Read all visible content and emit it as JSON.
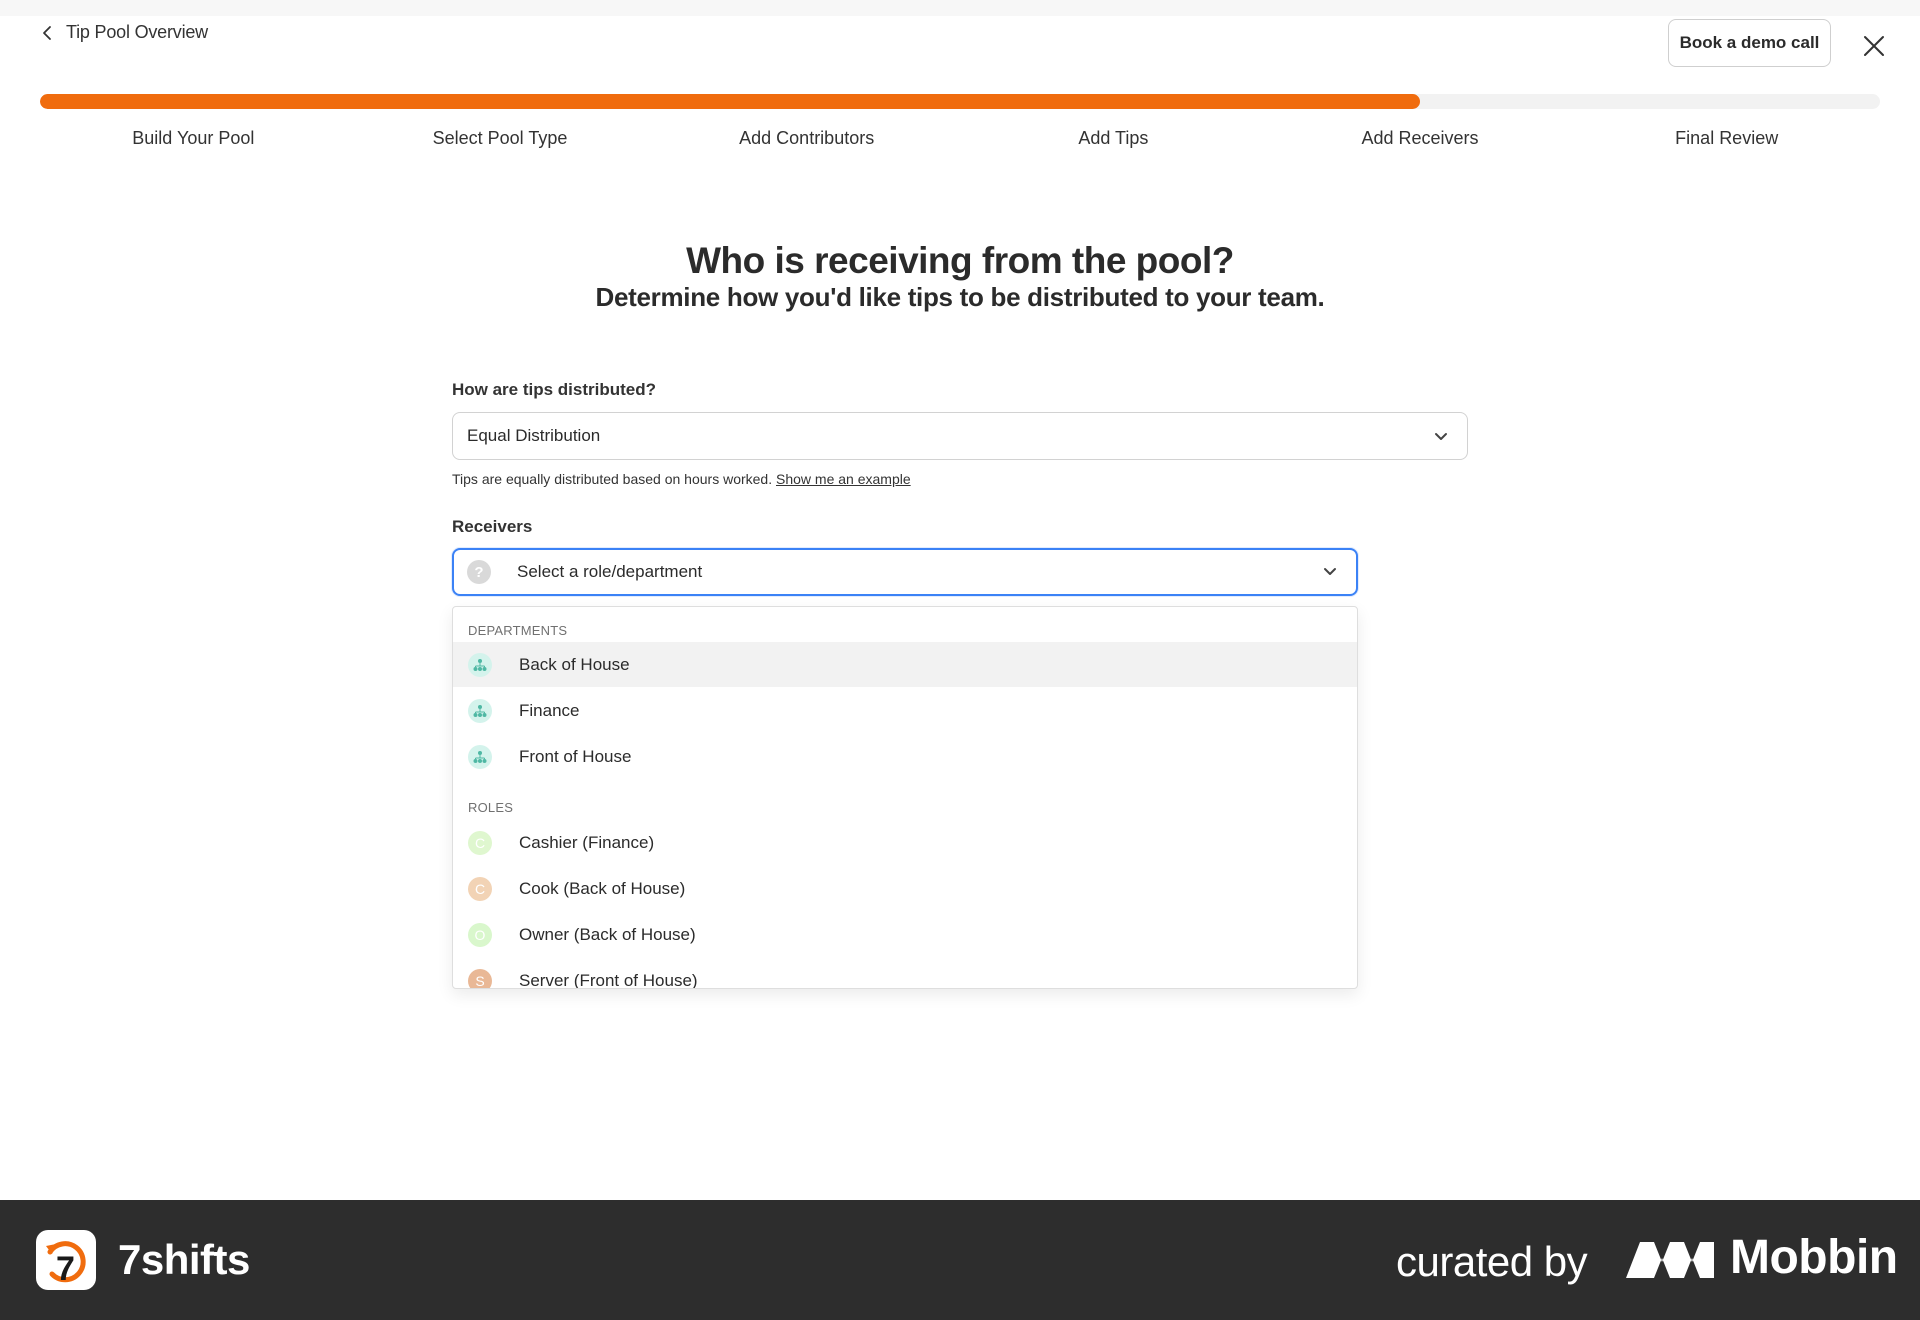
{
  "header": {
    "back_label": "Tip Pool Overview",
    "demo_button": "Book a demo call",
    "close_icon": "close-icon"
  },
  "progress": {
    "fraction": 0.75,
    "color": "#f06c0e",
    "steps": [
      "Build Your Pool",
      "Select Pool Type",
      "Add Contributors",
      "Add Tips",
      "Add Receivers",
      "Final Review"
    ]
  },
  "main": {
    "title": "Who is receiving from the pool?",
    "subtitle": "Determine how you'd like tips to be distributed to your team.",
    "distribution_label": "How are tips distributed?",
    "distribution_value": "Equal Distribution",
    "hint_text": "Tips are equally distributed based on hours worked.",
    "hint_link": "Show me an example",
    "receivers_label": "Receivers",
    "receivers_placeholder": "Select a role/department"
  },
  "dropdown": {
    "departments_label": "DEPARTMENTS",
    "departments": [
      {
        "label": "Back of House",
        "icon": "department-icon",
        "highlighted": true
      },
      {
        "label": "Finance",
        "icon": "department-icon",
        "highlighted": false
      },
      {
        "label": "Front of House",
        "icon": "department-icon",
        "highlighted": false
      }
    ],
    "roles_label": "ROLES",
    "roles": [
      {
        "label": "Cashier (Finance)",
        "initial": "C",
        "color": "#dff7cf"
      },
      {
        "label": "Cook (Back of House)",
        "initial": "C",
        "color": "#f2d3b5"
      },
      {
        "label": "Owner (Back of House)",
        "initial": "O",
        "color": "#d9f7cc"
      },
      {
        "label": "Server (Front of House)",
        "initial": "S",
        "color": "#e9b896"
      }
    ]
  },
  "footer": {
    "app_name": "7shifts",
    "curated_by": "curated by",
    "brand": "Mobbin"
  }
}
